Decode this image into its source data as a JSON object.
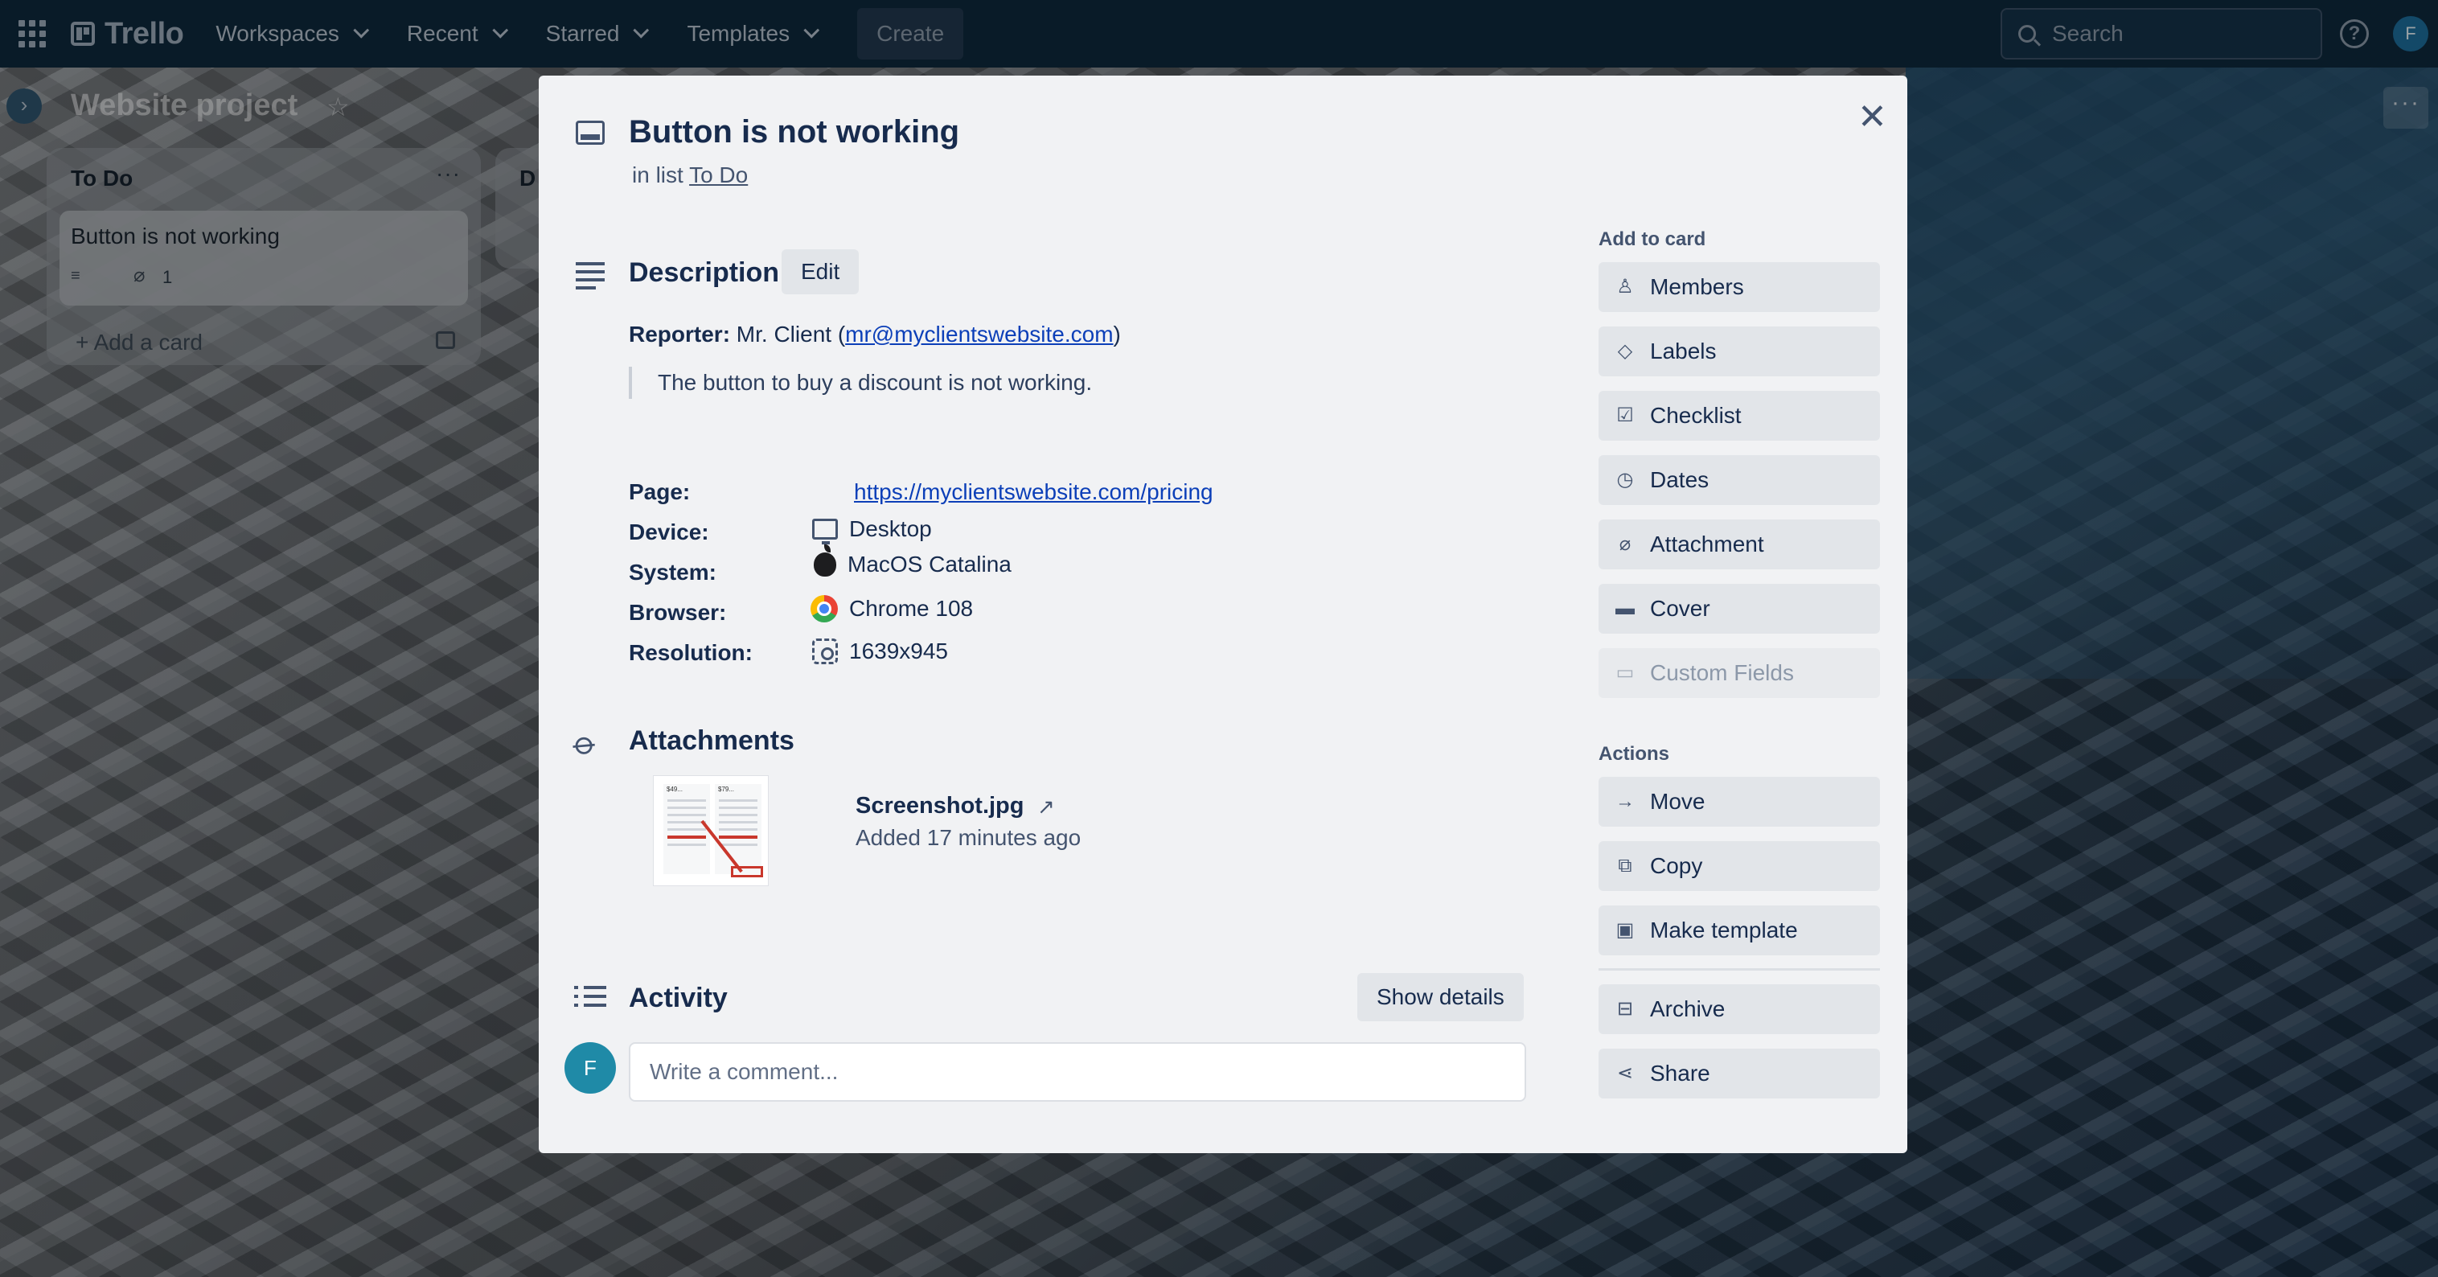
{
  "header": {
    "logo": "Trello",
    "nav": [
      "Workspaces",
      "Recent",
      "Starred",
      "Templates"
    ],
    "create": "Create",
    "search_placeholder": "Search",
    "help": "?",
    "avatar": "F"
  },
  "board": {
    "title": "Website project",
    "expand": "›",
    "star": "☆",
    "more": "···",
    "lists": [
      {
        "title": "To Do",
        "more": "···",
        "cards": [
          {
            "title": "Button is not working",
            "attachments": "1"
          }
        ],
        "add_card": "+ Add a card"
      },
      {
        "title": "D"
      }
    ]
  },
  "modal": {
    "title": "Button is not working",
    "in_list_prefix": "in list",
    "list_name": "To Do",
    "close": "✕",
    "description": {
      "heading": "Description",
      "edit": "Edit",
      "reporter_label": "Reporter:",
      "reporter_name": "Mr. Client",
      "reporter_email": "mr@myclientswebsite.com",
      "quote": "The button to buy a discount is not working.",
      "fields": {
        "page": {
          "label": "Page:",
          "value": "https://myclientswebsite.com/pricing"
        },
        "device": {
          "label": "Device:",
          "value": "Desktop"
        },
        "system": {
          "label": "System:",
          "value": "MacOS Catalina"
        },
        "browser": {
          "label": "Browser:",
          "value": "Chrome 108"
        },
        "resolution": {
          "label": "Resolution:",
          "value": "1639x945"
        }
      }
    },
    "attachments": {
      "heading": "Attachments",
      "file_name": "Screenshot.jpg",
      "open_icon": "↗",
      "added": "Added 17 minutes ago",
      "thumb_prices": [
        "$49...",
        "$79..."
      ]
    },
    "activity": {
      "heading": "Activity",
      "show_details": "Show details",
      "avatar": "F",
      "comment_placeholder": "Write a comment..."
    },
    "sidebar": {
      "add_to_card_heading": "Add to card",
      "add_to_card": [
        {
          "label": "Members",
          "icon": "person-icon"
        },
        {
          "label": "Labels",
          "icon": "tag-icon"
        },
        {
          "label": "Checklist",
          "icon": "checkbox-icon"
        },
        {
          "label": "Dates",
          "icon": "clock-icon"
        },
        {
          "label": "Attachment",
          "icon": "paperclip-icon"
        },
        {
          "label": "Cover",
          "icon": "cover-icon"
        },
        {
          "label": "Custom Fields",
          "icon": "custom-fields-icon"
        }
      ],
      "actions_heading": "Actions",
      "actions": [
        {
          "label": "Move",
          "icon": "arrow-right-icon"
        },
        {
          "label": "Copy",
          "icon": "copy-icon"
        },
        {
          "label": "Make template",
          "icon": "template-icon"
        },
        {
          "label": "Archive",
          "icon": "archive-icon"
        },
        {
          "label": "Share",
          "icon": "share-icon"
        }
      ]
    }
  },
  "colors": {
    "header_bg": "#0f2a3e",
    "modal_bg": "#f1f2f4",
    "link": "#0c3fb8",
    "button_bg": "#e2e5e9"
  }
}
